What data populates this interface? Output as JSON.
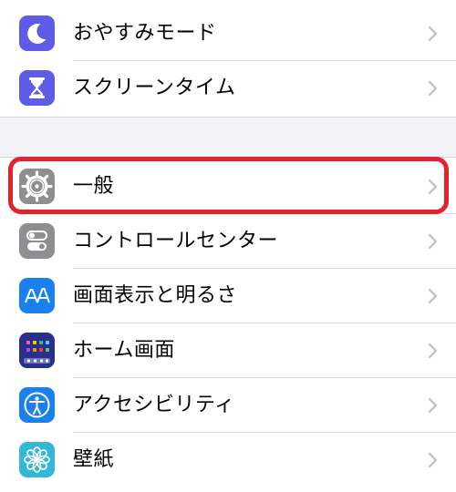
{
  "settings": {
    "items": [
      {
        "label": "おやすみモード",
        "icon": "moon-icon",
        "color": "#5e5ce6"
      },
      {
        "label": "スクリーンタイム",
        "icon": "hourglass-icon",
        "color": "#5e5ce6"
      },
      {
        "label": "一般",
        "icon": "gear-icon",
        "color": "#8e8e93"
      },
      {
        "label": "コントロールセンター",
        "icon": "toggles-icon",
        "color": "#8e8e93"
      },
      {
        "label": "画面表示と明るさ",
        "icon": "text-size-icon",
        "color": "#1a80f0"
      },
      {
        "label": "ホーム画面",
        "icon": "app-grid-icon",
        "color": "#2d3fb8"
      },
      {
        "label": "アクセシビリティ",
        "icon": "accessibility-icon",
        "color": "#1a80f0"
      },
      {
        "label": "壁紙",
        "icon": "flower-icon",
        "color": "#33b6d8"
      }
    ]
  },
  "highlight": {
    "target": "一般",
    "color": "#e4212c"
  }
}
